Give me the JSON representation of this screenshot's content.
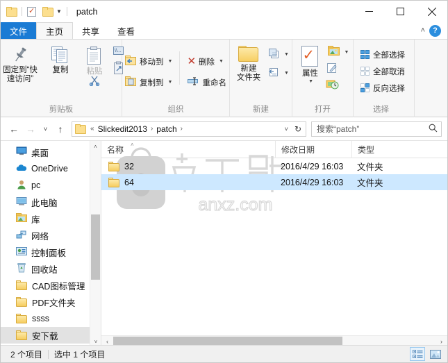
{
  "window": {
    "title": "patch",
    "quick_access": [
      "folder-icon",
      "properties-icon",
      "new-folder-icon"
    ],
    "minimize_label": "─",
    "maximize_label": "□",
    "close_label": "✕"
  },
  "tabs": [
    {
      "label": "文件",
      "name": "tab-file"
    },
    {
      "label": "主页",
      "name": "tab-home"
    },
    {
      "label": "共享",
      "name": "tab-share"
    },
    {
      "label": "查看",
      "name": "tab-view"
    }
  ],
  "tabstrip_right": {
    "collapse": "˄",
    "help": "?"
  },
  "ribbon": {
    "clipboard": {
      "group_label": "剪贴板",
      "pin_label": "固定到“快速访问”",
      "pin_line1": "固定到“快",
      "pin_line2": "速访问”",
      "copy_label": "复制",
      "paste_label": "粘贴",
      "cut_label": "剪切",
      "copy_path_label": "复制路径",
      "paste_shortcut_label": "粘贴快捷方式"
    },
    "organize": {
      "group_label": "组织",
      "move_to_label": "移动到",
      "copy_to_label": "复制到",
      "delete_label": "删除",
      "rename_label": "重命名"
    },
    "new": {
      "group_label": "新建",
      "new_folder_line1": "新建",
      "new_folder_line2": "文件夹",
      "new_item_label": "新建项目",
      "easy_access_label": "轻松访问"
    },
    "open": {
      "group_label": "打开",
      "properties_label": "属性",
      "open_label": "打开",
      "edit_label": "编辑",
      "history_label": "历史记录"
    },
    "select": {
      "group_label": "选择",
      "select_all_label": "全部选择",
      "select_none_label": "全部取消",
      "invert_label": "反向选择"
    }
  },
  "navbar": {
    "back": "←",
    "forward": "→",
    "recent": "˅",
    "up": "↑",
    "overflow": "«",
    "crumbs": [
      "Slickedit2013",
      "patch"
    ],
    "separator": "›",
    "dropdown": "˅",
    "refresh": "↻"
  },
  "search": {
    "placeholder": "搜索“patch”",
    "icon": "search-icon"
  },
  "sidebar": {
    "items": [
      {
        "label": "桌面",
        "icon": "desktop-icon",
        "selected": false
      },
      {
        "label": "OneDrive",
        "icon": "onedrive-icon",
        "selected": false
      },
      {
        "label": "pc",
        "icon": "user-icon",
        "selected": false
      },
      {
        "label": "此电脑",
        "icon": "this-pc-icon",
        "selected": false
      },
      {
        "label": "库",
        "icon": "library-icon",
        "selected": false
      },
      {
        "label": "网络",
        "icon": "network-icon",
        "selected": false
      },
      {
        "label": "控制面板",
        "icon": "control-panel-icon",
        "selected": false
      },
      {
        "label": "回收站",
        "icon": "recycle-bin-icon",
        "selected": false
      },
      {
        "label": "CAD图标管理",
        "icon": "folder-icon",
        "selected": false
      },
      {
        "label": "PDF文件夹",
        "icon": "folder-icon",
        "selected": false
      },
      {
        "label": "ssss",
        "icon": "folder-icon",
        "selected": false
      },
      {
        "label": "安下载",
        "icon": "folder-icon",
        "selected": true
      }
    ],
    "scroll_up": "˄",
    "scroll_down": "˅"
  },
  "filelist": {
    "columns": [
      {
        "label": "名称",
        "sorted": true
      },
      {
        "label": "修改日期",
        "sorted": false
      },
      {
        "label": "类型",
        "sorted": false
      }
    ],
    "sort_arrow": "˄",
    "rows": [
      {
        "name": "32",
        "date": "2016/4/29 16:03",
        "type": "文件夹",
        "selected": false
      },
      {
        "name": "64",
        "date": "2016/4/29 16:03",
        "type": "文件夹",
        "selected": true
      }
    ],
    "watermark_text": "anxz.com",
    "watermark_cn": "安下载",
    "hscroll_left": "‹",
    "hscroll_right": "›"
  },
  "statusbar": {
    "item_count": "2 个项目",
    "selection": "选中 1 个项目",
    "view_details": "details-view-icon",
    "view_large_icons": "large-icons-view-icon"
  },
  "colors": {
    "accent": "#1a7bd4",
    "selection": "#cde8ff",
    "folder": "#f7cf63",
    "ribbon_bg": "#f7f7f7",
    "status_bg": "#f0f0f0"
  }
}
